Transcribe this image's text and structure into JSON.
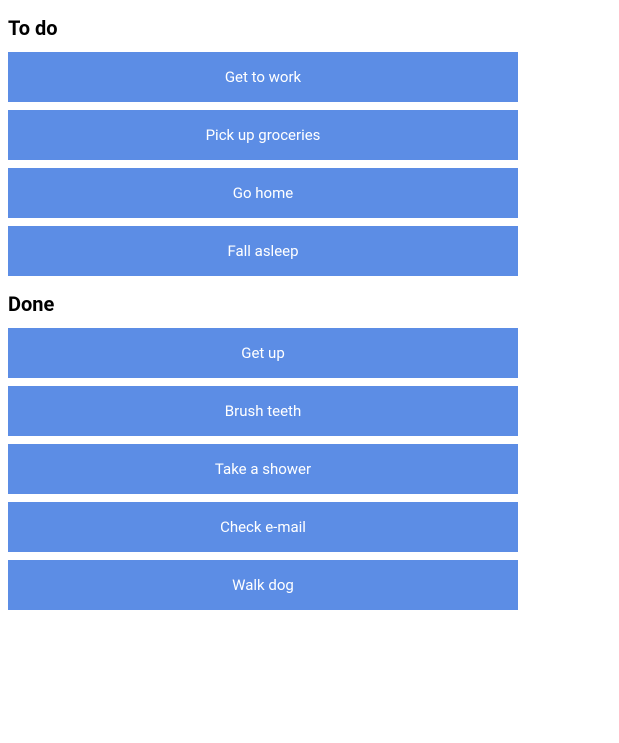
{
  "sections": {
    "todo": {
      "title": "To do",
      "items": [
        {
          "label": "Get to work"
        },
        {
          "label": "Pick up groceries"
        },
        {
          "label": "Go home"
        },
        {
          "label": "Fall asleep"
        }
      ]
    },
    "done": {
      "title": "Done",
      "items": [
        {
          "label": "Get up"
        },
        {
          "label": "Brush teeth"
        },
        {
          "label": "Take a shower"
        },
        {
          "label": "Check e-mail"
        },
        {
          "label": "Walk dog"
        }
      ]
    }
  }
}
